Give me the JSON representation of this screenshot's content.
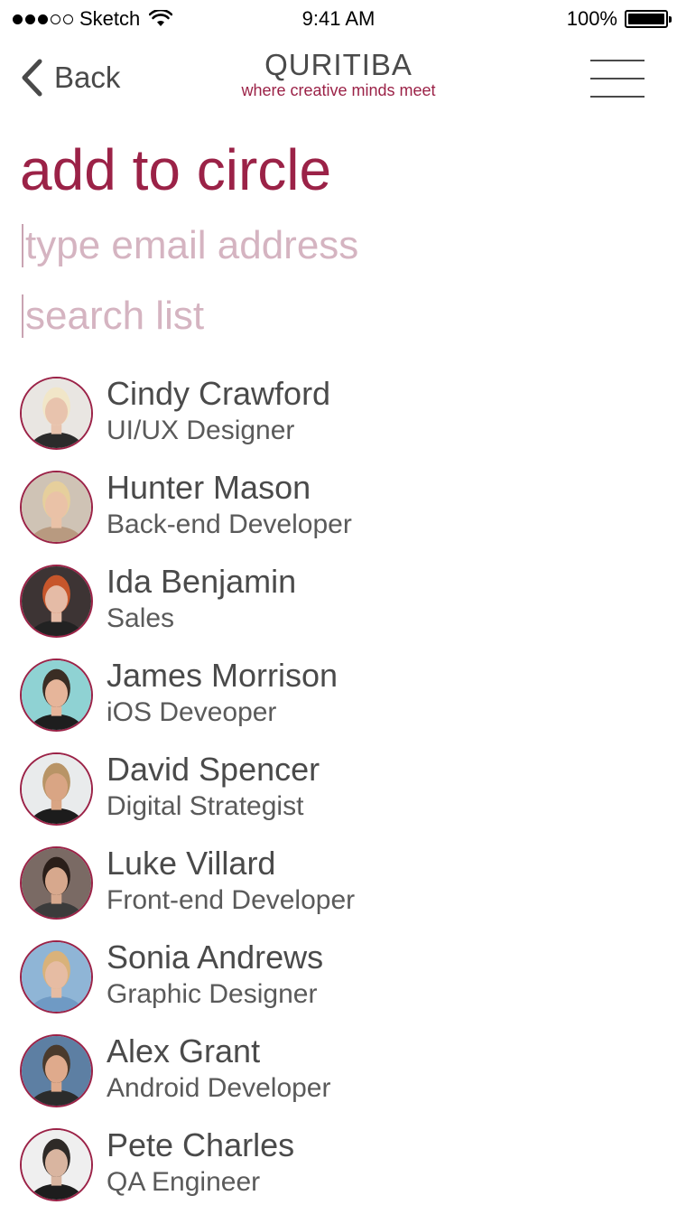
{
  "status_bar": {
    "carrier": "Sketch",
    "time": "9:41 AM",
    "battery": "100%"
  },
  "nav": {
    "back_label": "Back",
    "brand_name": "QURITIBA",
    "brand_tagline": "where creative minds meet",
    "menu_icon": "hamburger-menu-icon"
  },
  "page_title": "add to circle",
  "email_field": {
    "placeholder": "type email address",
    "value": ""
  },
  "search_field": {
    "placeholder": "search list",
    "value": ""
  },
  "colors": {
    "accent": "#9b2247",
    "placeholder": "#d5b4c1",
    "text": "#4a4a4a"
  },
  "contacts": [
    {
      "name": "Cindy Crawford",
      "role": "UI/UX Designer",
      "avatar_bg": "#e9e6e2",
      "hair": "#f1e6c8",
      "skin": "#e8c3ad",
      "shirt": "#2b2b2b"
    },
    {
      "name": "Hunter Mason",
      "role": "Back-end Developer",
      "avatar_bg": "#cfc3b5",
      "hair": "#e6cf9c",
      "skin": "#eac2a7",
      "shirt": "#b89a80"
    },
    {
      "name": "Ida Benjamin",
      "role": "Sales",
      "avatar_bg": "#3d3434",
      "hair": "#c7562b",
      "skin": "#e5bba6",
      "shirt": "#222222"
    },
    {
      "name": "James Morrison",
      "role": "iOS Deveoper",
      "avatar_bg": "#8fd2d3",
      "hair": "#3a2d24",
      "skin": "#e6b59a",
      "shirt": "#1e1e1e"
    },
    {
      "name": "David Spencer",
      "role": "Digital Strategist",
      "avatar_bg": "#e9ebec",
      "hair": "#b89466",
      "skin": "#d9a584",
      "shirt": "#1c1c1c"
    },
    {
      "name": "Luke Villard",
      "role": "Front-end Developer",
      "avatar_bg": "#7a6a64",
      "hair": "#2a1e19",
      "skin": "#d7a88d",
      "shirt": "#3b3b3b"
    },
    {
      "name": "Sonia Andrews",
      "role": "Graphic Designer",
      "avatar_bg": "#8fb5d6",
      "hair": "#d9b27a",
      "skin": "#e6bca3",
      "shirt": "#6f9ac4"
    },
    {
      "name": "Alex Grant",
      "role": "Android Developer",
      "avatar_bg": "#5d7fa3",
      "hair": "#4a3a2c",
      "skin": "#dfaa8c",
      "shirt": "#2b2b2b"
    },
    {
      "name": "Pete Charles",
      "role": "QA Engineer",
      "avatar_bg": "#efefef",
      "hair": "#2e2a27",
      "skin": "#d9b5a0",
      "shirt": "#1d1d1d"
    }
  ]
}
